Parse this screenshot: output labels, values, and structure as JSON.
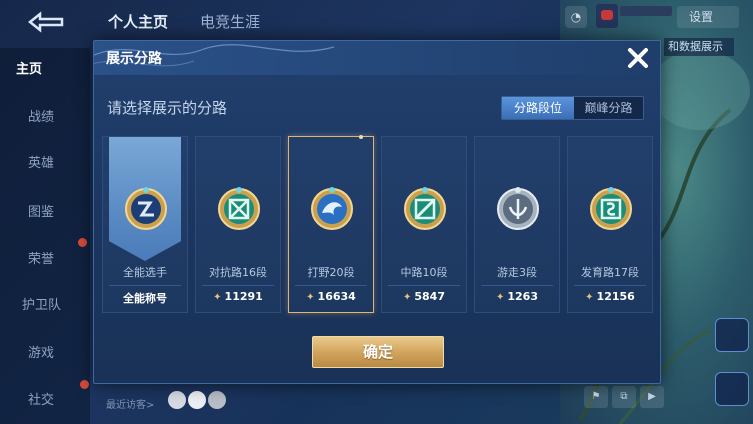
{
  "nav": {
    "back_icon": "back-arrow-icon",
    "tabs": [
      {
        "label": "个人主页",
        "active": true
      },
      {
        "label": "电竞生涯",
        "active": false
      }
    ],
    "settings_label": "设置",
    "behind_tag": "和数据展示"
  },
  "sidebar": {
    "items": [
      {
        "label": "主页",
        "active": true
      },
      {
        "label": "战绩",
        "active": false
      },
      {
        "label": "英雄",
        "active": false
      },
      {
        "label": "图鉴",
        "active": false
      },
      {
        "label": "荣誉",
        "active": false
      },
      {
        "label": "护卫队",
        "active": false
      },
      {
        "label": "游戏",
        "active": false
      },
      {
        "label": "社交",
        "active": false
      }
    ]
  },
  "footer": {
    "recent_visitors": "最近访客>"
  },
  "modal": {
    "title": "展示分路",
    "close_icon": "close-icon",
    "subtitle": "请选择展示的分路",
    "toggle": {
      "on": "分路段位",
      "off": "巅峰分路"
    },
    "cards": [
      {
        "name": "全能选手",
        "value": "全能称号",
        "emblem": "all-round-emblem-icon",
        "has_coin": false,
        "selected": false,
        "banner": true
      },
      {
        "name": "对抗路16段",
        "value": "11291",
        "emblem": "clash-lane-emblem-icon",
        "has_coin": true,
        "selected": false,
        "banner": false
      },
      {
        "name": "打野20段",
        "value": "16634",
        "emblem": "jungle-emblem-icon",
        "has_coin": true,
        "selected": true,
        "banner": false
      },
      {
        "name": "中路10段",
        "value": "5847",
        "emblem": "mid-lane-emblem-icon",
        "has_coin": true,
        "selected": false,
        "banner": false
      },
      {
        "name": "游走3段",
        "value": "1263",
        "emblem": "roam-emblem-icon",
        "has_coin": true,
        "selected": false,
        "banner": false
      },
      {
        "name": "发育路17段",
        "value": "12156",
        "emblem": "farm-lane-emblem-icon",
        "has_coin": true,
        "selected": false,
        "banner": false
      }
    ],
    "confirm_label": "确定"
  },
  "colors": {
    "accent_gold": "#e1b377",
    "toggle_active": "#4a83cc",
    "modal_bg": "#1d385f"
  }
}
